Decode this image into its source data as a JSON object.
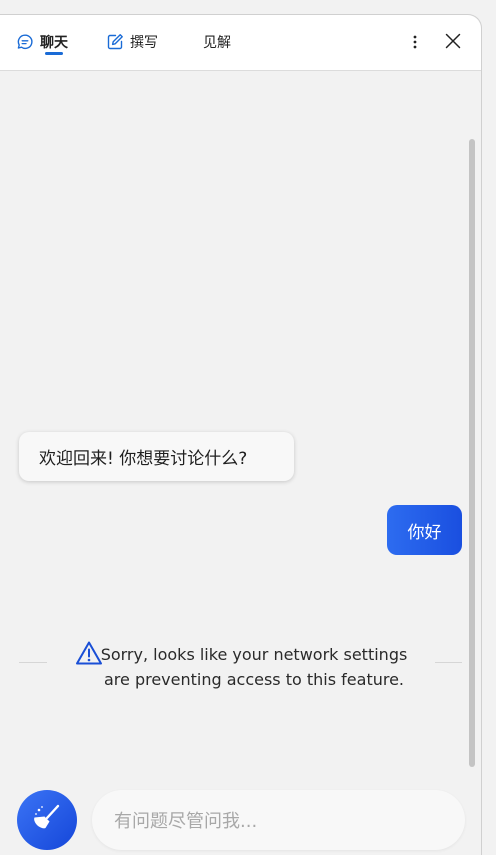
{
  "header": {
    "tabs": [
      {
        "label": "聊天",
        "icon": "chat-bubble-icon",
        "active": true
      },
      {
        "label": "撰写",
        "icon": "edit-icon",
        "active": false
      },
      {
        "label": "见解",
        "icon": "",
        "active": false
      }
    ],
    "more_icon": "more-vertical-icon",
    "close_icon": "close-icon"
  },
  "chat": {
    "messages": [
      {
        "role": "assistant",
        "text": "欢迎回来! 你想要讨论什么?"
      },
      {
        "role": "user",
        "text": "你好"
      }
    ],
    "notice": {
      "icon": "warning-icon",
      "text": "Sorry, looks like your network settings are preventing access to this feature."
    }
  },
  "composer": {
    "clear_icon": "broom-icon",
    "placeholder": "有问题尽管问我..."
  },
  "colors": {
    "accent": "#1a6bd6",
    "user_bubble": "#2d6cf0",
    "background": "#f2f2f2"
  }
}
